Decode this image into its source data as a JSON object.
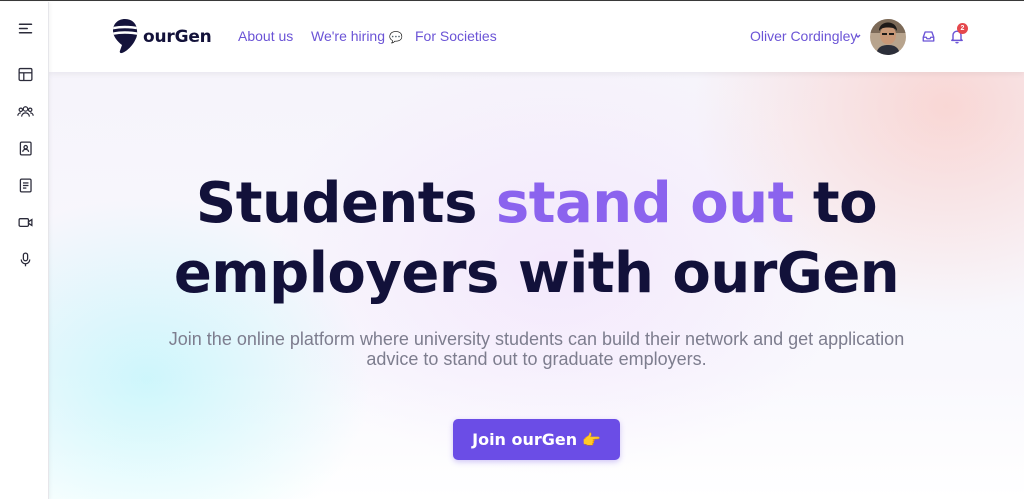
{
  "brand": {
    "name": "ourGen"
  },
  "nav": {
    "about": "About us",
    "hiring": "We're hiring",
    "hiring_icon": "💬",
    "societies": "For Societies"
  },
  "user": {
    "name": "Oliver Cordingley",
    "notification_count": "2"
  },
  "sidebar": {
    "items": [
      {
        "icon": "menu-icon"
      },
      {
        "icon": "layout-icon"
      },
      {
        "icon": "users-icon"
      },
      {
        "icon": "contact-book-icon"
      },
      {
        "icon": "notebook-icon"
      },
      {
        "icon": "video-icon"
      },
      {
        "icon": "microphone-icon"
      }
    ]
  },
  "hero": {
    "headline_part1": "Students ",
    "headline_accent": "stand out",
    "headline_part2": " to employers with ourGen",
    "subtext": "Join the online platform where university students can build their network and get application advice to stand out to graduate employers.",
    "cta_label": "Join ourGen",
    "cta_emoji": "👉"
  },
  "colors": {
    "accent": "#8b63ee",
    "primary_button": "#6b4de6",
    "nav_link": "#6b54d6",
    "heading": "#12113a",
    "badge": "#e5484d"
  }
}
